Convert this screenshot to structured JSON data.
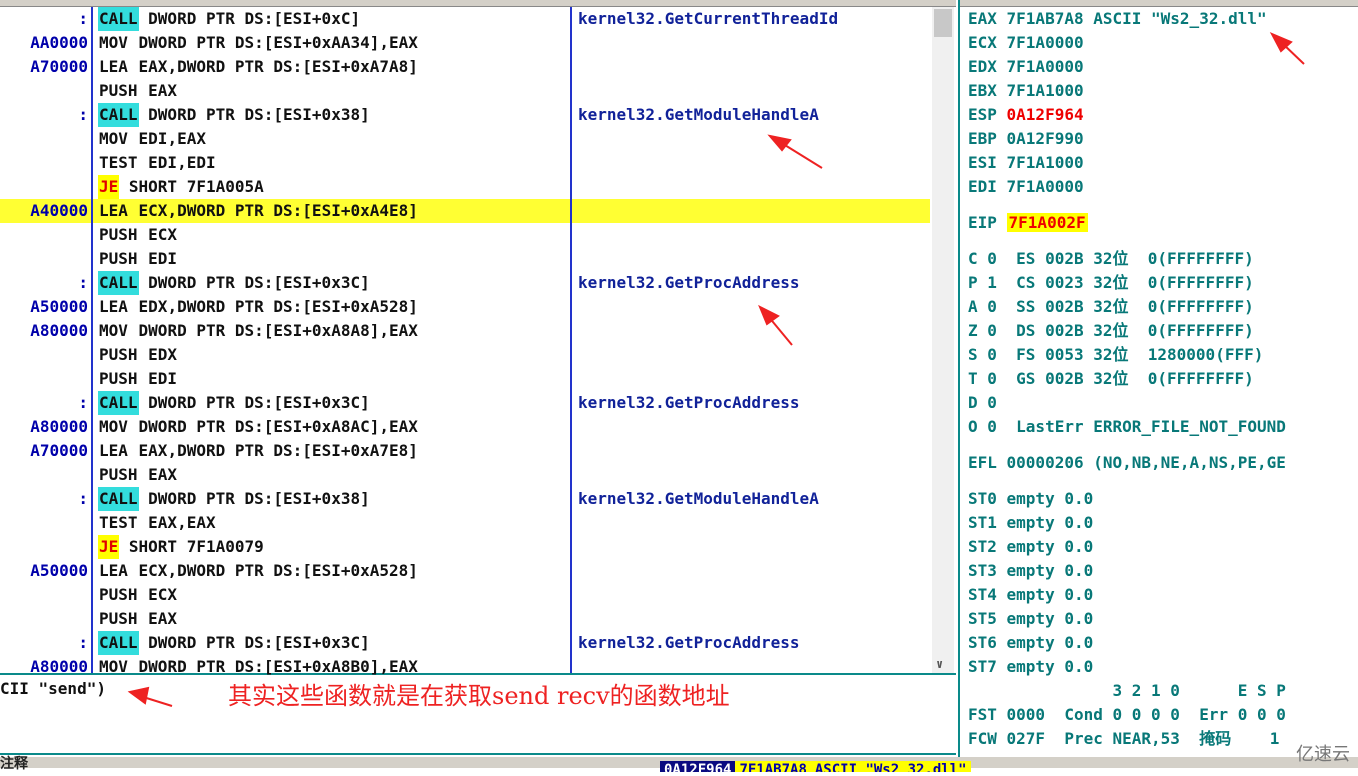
{
  "disasm": {
    "rows": [
      {
        "addr": ":",
        "mn": "CALL",
        "ops": " DWORD PTR DS:[ESI+0xC]",
        "comment": "kernel32.GetCurrentThreadId",
        "kind": "call"
      },
      {
        "addr": "AA0000",
        "mn": "MOV",
        "ops": " DWORD PTR DS:[ESI+0xAA34],EAX",
        "comment": "",
        "kind": ""
      },
      {
        "addr": "A70000",
        "mn": "LEA",
        "ops": " EAX,DWORD PTR DS:[ESI+0xA7A8]",
        "comment": "",
        "kind": ""
      },
      {
        "addr": "",
        "mn": "PUSH",
        "ops": " EAX",
        "comment": "",
        "kind": ""
      },
      {
        "addr": ":",
        "mn": "CALL",
        "ops": " DWORD PTR DS:[ESI+0x38]",
        "comment": "kernel32.GetModuleHandleA",
        "kind": "call"
      },
      {
        "addr": "",
        "mn": "MOV",
        "ops": " EDI,EAX",
        "comment": "",
        "kind": ""
      },
      {
        "addr": "",
        "mn": "TEST",
        "ops": " EDI,EDI",
        "comment": "",
        "kind": ""
      },
      {
        "addr": "",
        "mn": "JE",
        "ops": " SHORT 7F1A005A",
        "comment": "",
        "kind": "je"
      },
      {
        "addr": "A40000",
        "mn": "LEA",
        "ops": " ECX,DWORD PTR DS:[ESI+0xA4E8]",
        "comment": "",
        "kind": "",
        "selected": true
      },
      {
        "addr": "",
        "mn": "PUSH",
        "ops": " ECX",
        "comment": "",
        "kind": ""
      },
      {
        "addr": "",
        "mn": "PUSH",
        "ops": " EDI",
        "comment": "",
        "kind": ""
      },
      {
        "addr": ":",
        "mn": "CALL",
        "ops": " DWORD PTR DS:[ESI+0x3C]",
        "comment": "kernel32.GetProcAddress",
        "kind": "call"
      },
      {
        "addr": "A50000",
        "mn": "LEA",
        "ops": " EDX,DWORD PTR DS:[ESI+0xA528]",
        "comment": "",
        "kind": ""
      },
      {
        "addr": "A80000",
        "mn": "MOV",
        "ops": " DWORD PTR DS:[ESI+0xA8A8],EAX",
        "comment": "",
        "kind": ""
      },
      {
        "addr": "",
        "mn": "PUSH",
        "ops": " EDX",
        "comment": "",
        "kind": ""
      },
      {
        "addr": "",
        "mn": "PUSH",
        "ops": " EDI",
        "comment": "",
        "kind": ""
      },
      {
        "addr": ":",
        "mn": "CALL",
        "ops": " DWORD PTR DS:[ESI+0x3C]",
        "comment": "kernel32.GetProcAddress",
        "kind": "call"
      },
      {
        "addr": "A80000",
        "mn": "MOV",
        "ops": " DWORD PTR DS:[ESI+0xA8AC],EAX",
        "comment": "",
        "kind": ""
      },
      {
        "addr": "A70000",
        "mn": "LEA",
        "ops": " EAX,DWORD PTR DS:[ESI+0xA7E8]",
        "comment": "",
        "kind": ""
      },
      {
        "addr": "",
        "mn": "PUSH",
        "ops": " EAX",
        "comment": "",
        "kind": ""
      },
      {
        "addr": ":",
        "mn": "CALL",
        "ops": " DWORD PTR DS:[ESI+0x38]",
        "comment": "kernel32.GetModuleHandleA",
        "kind": "call"
      },
      {
        "addr": "",
        "mn": "TEST",
        "ops": " EAX,EAX",
        "comment": "",
        "kind": ""
      },
      {
        "addr": "",
        "mn": "JE",
        "ops": " SHORT 7F1A0079",
        "comment": "",
        "kind": "je"
      },
      {
        "addr": "A50000",
        "mn": "LEA",
        "ops": " ECX,DWORD PTR DS:[ESI+0xA528]",
        "comment": "",
        "kind": ""
      },
      {
        "addr": "",
        "mn": "PUSH",
        "ops": " ECX",
        "comment": "",
        "kind": ""
      },
      {
        "addr": "",
        "mn": "PUSH",
        "ops": " EAX",
        "comment": "",
        "kind": ""
      },
      {
        "addr": ":",
        "mn": "CALL",
        "ops": " DWORD PTR DS:[ESI+0x3C]",
        "comment": "kernel32.GetProcAddress",
        "kind": "call"
      },
      {
        "addr": "A80000",
        "mn": "MOV",
        "ops": " DWORD PTR DS:[ESI+0xA8B0],EAX",
        "comment": "",
        "kind": ""
      }
    ]
  },
  "info": {
    "text": "CII \"send\")"
  },
  "annotation": {
    "text": "其实这些函数就是在获取send recv的函数地址"
  },
  "registers": {
    "eax": "EAX 7F1AB7A8 ASCII \"Ws2_32.dll\"",
    "ecx": "ECX 7F1A0000",
    "edx": "EDX 7F1A0000",
    "ebx": "EBX 7F1A1000",
    "esp_label": "ESP ",
    "esp": "0A12F964",
    "ebp": "EBP 0A12F990",
    "esi": "ESI 7F1A1000",
    "edi": "EDI 7F1A0000",
    "eip_label": "EIP ",
    "eip": "7F1A002F",
    "flags": [
      "C 0  ES 002B 32位  0(FFFFFFFF)",
      "P 1  CS 0023 32位  0(FFFFFFFF)",
      "A 0  SS 002B 32位  0(FFFFFFFF)",
      "Z 0  DS 002B 32位  0(FFFFFFFF)",
      "S 0  FS 0053 32位  1280000(FFF)",
      "T 0  GS 002B 32位  0(FFFFFFFF)",
      "D 0",
      "O 0  LastErr ERROR_FILE_NOT_FOUND"
    ],
    "efl": "EFL 00000206 (NO,NB,NE,A,NS,PE,GE",
    "st": [
      "ST0 empty 0.0",
      "ST1 empty 0.0",
      "ST2 empty 0.0",
      "ST3 empty 0.0",
      "ST4 empty 0.0",
      "ST5 empty 0.0",
      "ST6 empty 0.0",
      "ST7 empty 0.0"
    ],
    "fhdr": "               3 2 1 0      E S P",
    "fst": "FST 0000  Cond 0 0 0 0  Err 0 0 0",
    "fcw": "FCW 027F  Prec NEAR,53  掩码    1"
  },
  "status": {
    "left": "注释",
    "dump": [
      "0A12F964",
      "7F1AB7A8",
      "ASCII \"Ws2_32.dll\""
    ]
  },
  "watermark": "亿速云",
  "colors": {
    "call_bg": "#33dddd",
    "je_bg": "#ffff00",
    "selected_row": "#ffff33",
    "annotation": "#ee2222",
    "register_text": "#087878"
  }
}
